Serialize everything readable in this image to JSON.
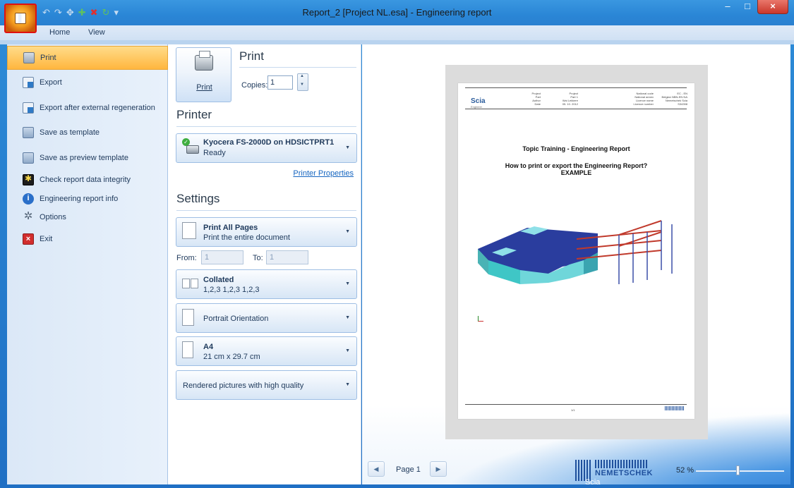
{
  "window": {
    "title": "Report_2 [Project NL.esa] - Engineering report",
    "minimize": "–",
    "maximize": "□",
    "close": "×"
  },
  "ribbon": {
    "tabs": [
      "Home",
      "View"
    ]
  },
  "menu": {
    "items": [
      {
        "label": "Print",
        "icon": "printer-icon"
      },
      {
        "label": "Export",
        "icon": "export-icon"
      },
      {
        "label": "Export after external regeneration",
        "icon": "export-regenerate-icon"
      },
      {
        "label": "Save as template",
        "icon": "template-icon"
      },
      {
        "label": "Save as preview template",
        "icon": "preview-template-icon"
      },
      {
        "label": "Check report data integrity",
        "icon": "integrity-icon"
      },
      {
        "label": "Engineering report info",
        "icon": "info-icon"
      },
      {
        "label": "Options",
        "icon": "gear-icon"
      },
      {
        "label": "Exit",
        "icon": "exit-icon"
      }
    ]
  },
  "print": {
    "heading": "Print",
    "button_label": "Print",
    "copies_label": "Copies:",
    "copies_value": "1"
  },
  "printer": {
    "heading": "Printer",
    "name": "Kyocera FS-2000D on HDSICTPRT1",
    "status": "Ready",
    "properties_link": "Printer Properties"
  },
  "settings": {
    "heading": "Settings",
    "pages_title": "Print All Pages",
    "pages_sub": "Print the entire document",
    "from_label": "From:",
    "from_value": "1",
    "to_label": "To:",
    "to_value": "1",
    "collate_title": "Collated",
    "collate_sub": "1,2,3   1,2,3   1,2,3",
    "orientation": "Portrait Orientation",
    "paper_title": "A4",
    "paper_sub": "21 cm x 29.7 cm",
    "quality": "Rendered pictures with high quality"
  },
  "preview": {
    "doc_title": "Topic Training - Engineering Report",
    "doc_subtitle1": "How to print or export the Engineering Report?",
    "doc_subtitle2": "EXAMPLE",
    "logo": "Scia",
    "logo_sub": "Engineer",
    "footer_page": "1/1",
    "header_left": [
      "Project",
      "Part",
      "Author",
      "Date"
    ],
    "header_mid": [
      "Project",
      "Part 1",
      "Wai Lekkere",
      "05. 10. 2012"
    ],
    "header_right_labels": [
      "National code",
      "National annex",
      "Licence name",
      "Licence number"
    ],
    "header_right_values": [
      "EC - EN",
      "Belgian NBN-EN NA",
      "Nemetschek Scia",
      "S34398"
    ]
  },
  "navigation": {
    "page_label": "Page 1",
    "prev": "◀",
    "next": "▶"
  },
  "brand": {
    "name": "NEMETSCHEK",
    "sub": "Scia"
  },
  "zoom": {
    "label": "52 %",
    "value_percent": 52
  }
}
